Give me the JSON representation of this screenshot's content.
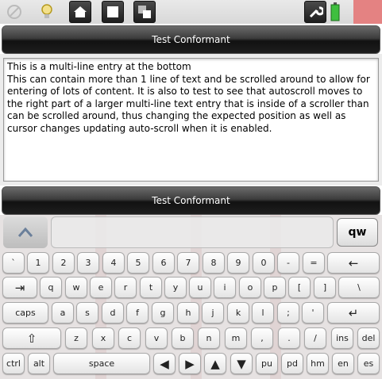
{
  "topbar": {
    "icons": [
      "no-entry-icon",
      "lightbulb-icon",
      "home-icon",
      "window-icon",
      "windows-stack-icon",
      "wrench-icon",
      "battery-icon"
    ]
  },
  "conformant_top": {
    "label": "Test Conformant"
  },
  "conformant_bottom": {
    "label": "Test Conformant"
  },
  "entry": {
    "text": "This is a multi-line entry at the bottom\nThis can contain more than 1 line of text and be scrolled around to allow for entering of lots of content. It is also to test to see that autoscroll moves to the right part of a larger multi-line text entry that is inside of a scroller than can be scrolled around, thus changing the expected position as well as cursor changes updating auto-scroll when it is enabled."
  },
  "keyboard": {
    "switch_label": "qw",
    "row1": [
      "`",
      "1",
      "2",
      "3",
      "4",
      "5",
      "6",
      "7",
      "8",
      "9",
      "0",
      "-",
      "=",
      "←"
    ],
    "row2": [
      "⇥",
      "q",
      "w",
      "e",
      "r",
      "t",
      "y",
      "u",
      "i",
      "o",
      "p",
      "[",
      "]",
      "\\"
    ],
    "row3": [
      "caps",
      "a",
      "s",
      "d",
      "f",
      "g",
      "h",
      "j",
      "k",
      "l",
      ";",
      "'",
      "↵"
    ],
    "row4": [
      "⇧",
      "z",
      "x",
      "c",
      "v",
      "b",
      "n",
      "m",
      ",",
      ".",
      "/",
      "ins",
      "del"
    ],
    "row5": [
      "ctrl",
      "alt",
      "space",
      "◀",
      "▶",
      "▲",
      "▼",
      "pu",
      "pd",
      "hm",
      "en",
      "es"
    ]
  },
  "colors": {
    "accent_red": "#e48282",
    "bar_dark": "#1e1e1e"
  }
}
